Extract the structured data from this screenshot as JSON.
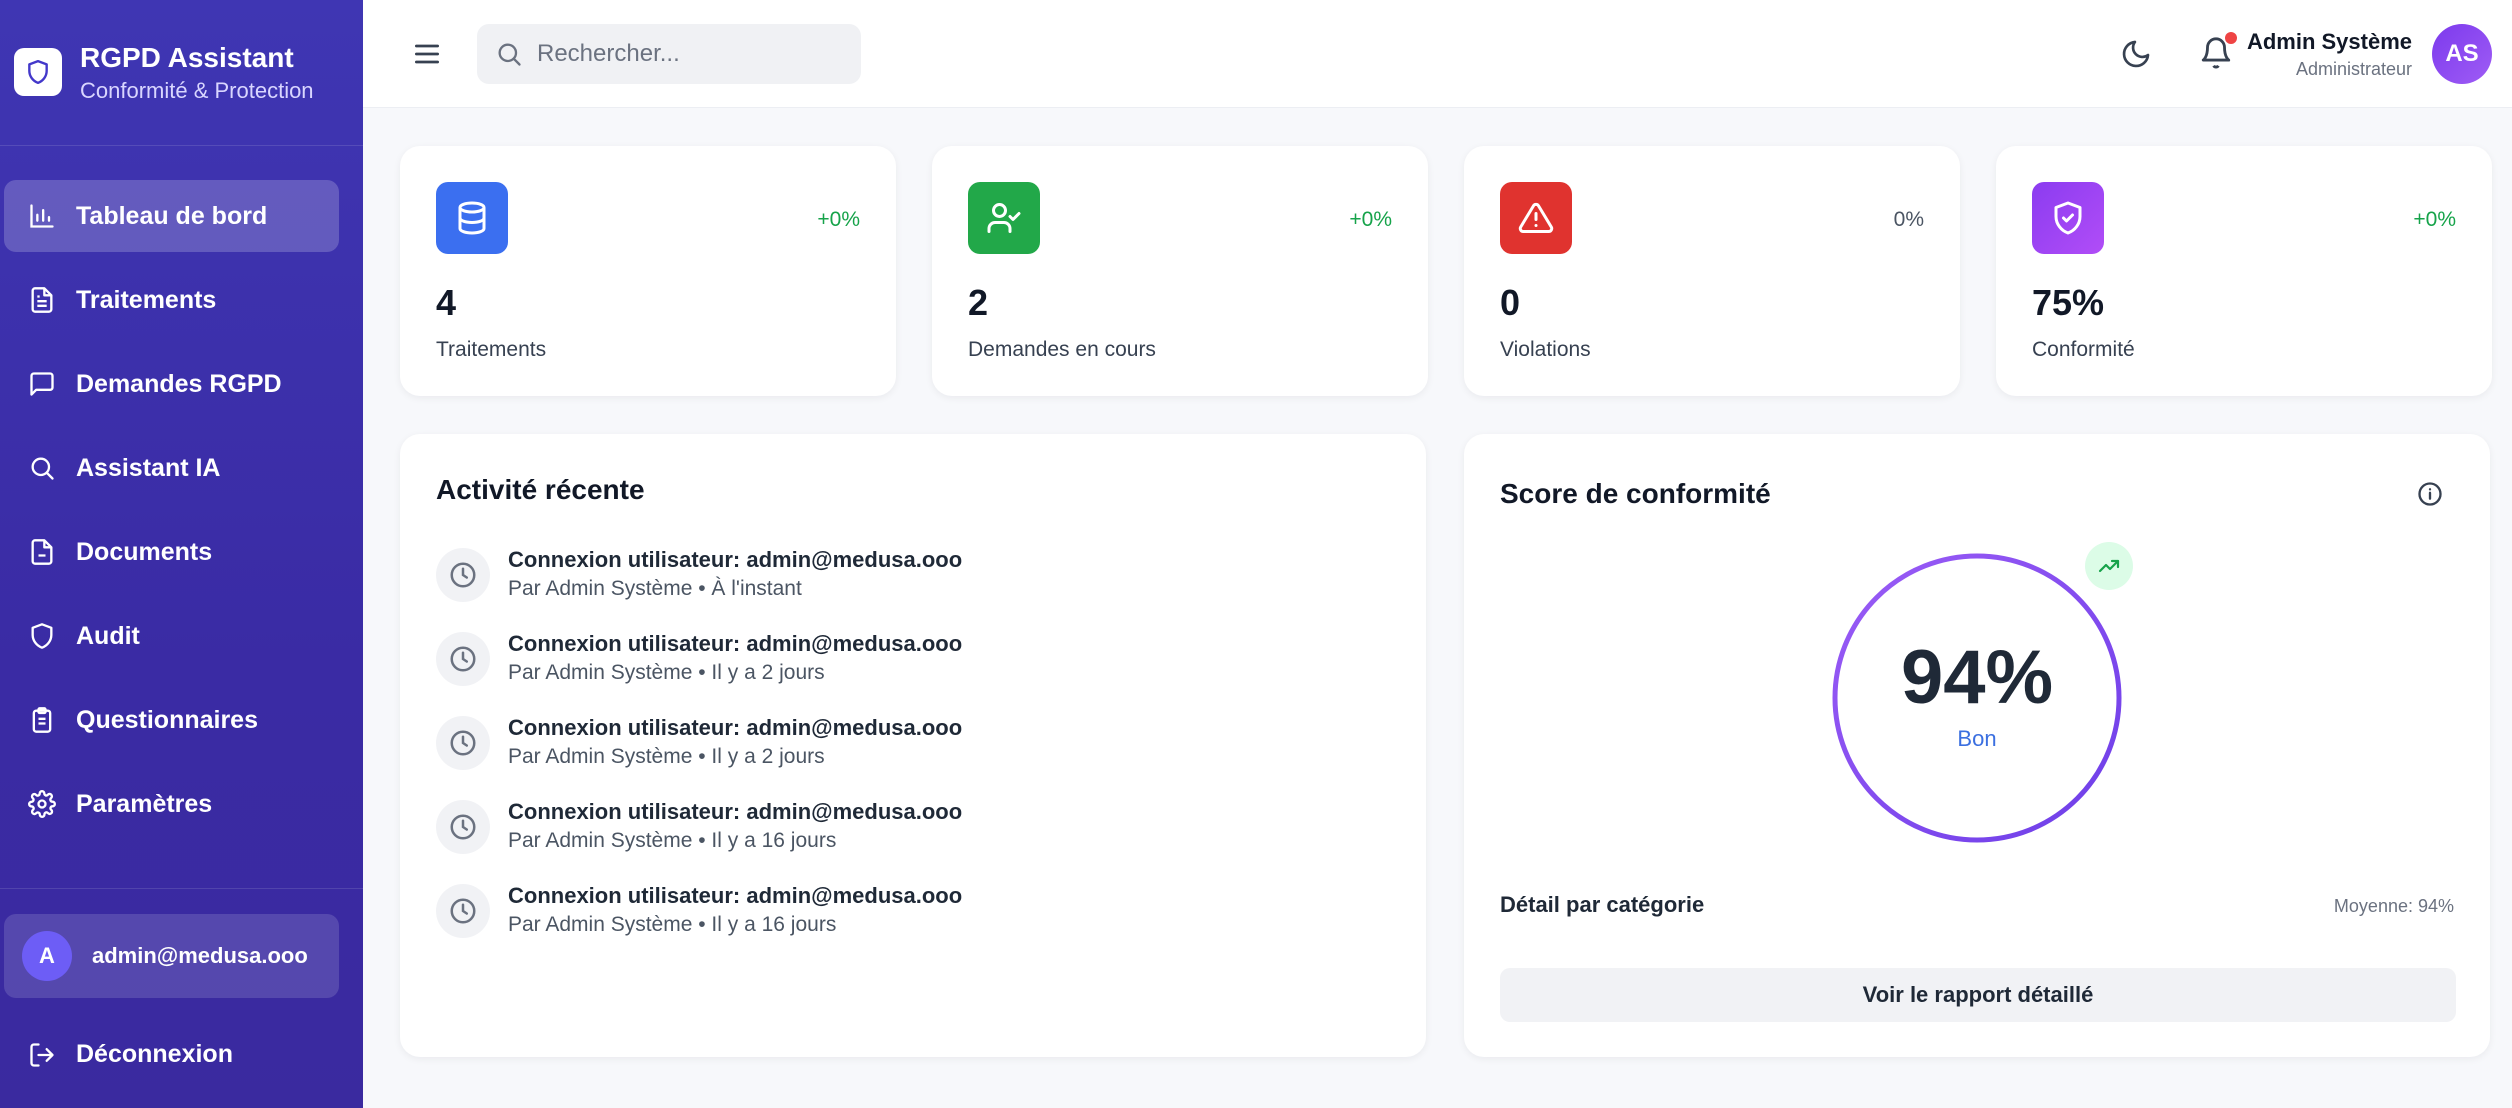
{
  "brand": {
    "title": "RGPD Assistant",
    "subtitle": "Conformité & Protection"
  },
  "sidebar": {
    "items": [
      {
        "label": "Tableau de bord",
        "icon": "bar-chart-icon",
        "active": true
      },
      {
        "label": "Traitements",
        "icon": "file-text-icon"
      },
      {
        "label": "Demandes RGPD",
        "icon": "message-square-icon"
      },
      {
        "label": "Assistant IA",
        "icon": "search-icon"
      },
      {
        "label": "Documents",
        "icon": "file-icon"
      },
      {
        "label": "Audit",
        "icon": "shield-icon"
      },
      {
        "label": "Questionnaires",
        "icon": "clipboard-icon"
      },
      {
        "label": "Paramètres",
        "icon": "gear-icon"
      }
    ],
    "user": {
      "initial": "A",
      "email": "admin@medusa.ooo"
    },
    "logout_label": "Déconnexion"
  },
  "header": {
    "search_placeholder": "Rechercher...",
    "user_name": "Admin Système",
    "user_role": "Administrateur",
    "avatar_initials": "AS",
    "has_notification": true
  },
  "stats": [
    {
      "value": "4",
      "label": "Traitements",
      "change": "+0%",
      "icon": "database-icon",
      "color": "#3b6ff0",
      "change_color": "#16a34a"
    },
    {
      "value": "2",
      "label": "Demandes en cours",
      "change": "+0%",
      "icon": "user-check-icon",
      "color": "#22a849",
      "change_color": "#16a34a"
    },
    {
      "value": "0",
      "label": "Violations",
      "change": "0%",
      "icon": "alert-triangle-icon",
      "color": "#e0332f",
      "change_color": "#4b5563"
    },
    {
      "value": "75%",
      "label": "Conformité",
      "change": "+0%",
      "icon": "shield-check-icon",
      "color": "#9b3cf0",
      "change_color": "#16a34a"
    }
  ],
  "activity": {
    "title": "Activité récente",
    "items": [
      {
        "title": "Connexion utilisateur: admin@medusa.ooo",
        "meta": "Par Admin Système • À l'instant"
      },
      {
        "title": "Connexion utilisateur: admin@medusa.ooo",
        "meta": "Par Admin Système • Il y a 2 jours"
      },
      {
        "title": "Connexion utilisateur: admin@medusa.ooo",
        "meta": "Par Admin Système • Il y a 2 jours"
      },
      {
        "title": "Connexion utilisateur: admin@medusa.ooo",
        "meta": "Par Admin Système • Il y a 16 jours"
      },
      {
        "title": "Connexion utilisateur: admin@medusa.ooo",
        "meta": "Par Admin Système • Il y a 16 jours"
      }
    ]
  },
  "score": {
    "title": "Score de conformité",
    "value": "94%",
    "rating": "Bon",
    "detail_label": "Détail par catégorie",
    "average": "Moyenne: 94%",
    "button_label": "Voir le rapport détaillé"
  }
}
